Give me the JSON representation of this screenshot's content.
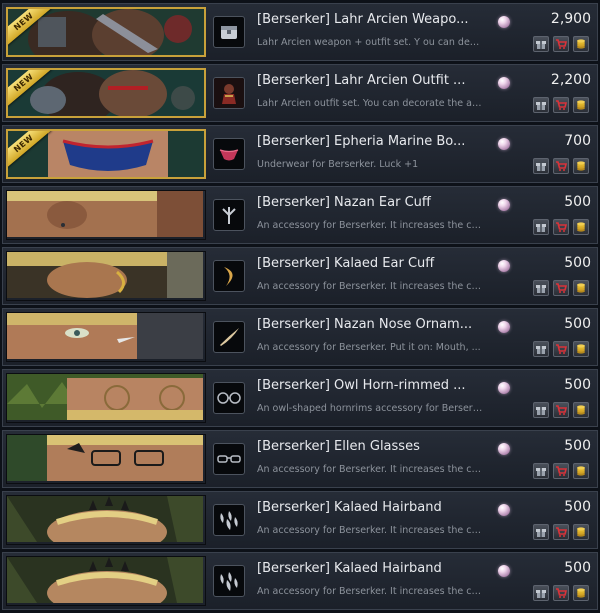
{
  "new_badge_text": "NEW",
  "colors": {
    "title": "#e8eaee",
    "description": "#8d939c",
    "price": "#f0f0f0",
    "new_badge": "#d1a726",
    "cart_icon": "#d9333a",
    "coin_icon": "#e0b52c"
  },
  "items": [
    {
      "title": "[Berserker] Lahr Arcien Weapo...",
      "description": "Lahr Arcien weapon + outfit set. Y ou can dec...",
      "price": "2,900",
      "is_new": true,
      "banner_scene": "armored-warrior-green",
      "thumb_icon": "chest-box-icon"
    },
    {
      "title": "[Berserker] Lahr Arcien Outfit ...",
      "description": "Lahr Arcien outfit set. You can decorate the ar...",
      "price": "2,200",
      "is_new": true,
      "banner_scene": "armored-warrior-teal",
      "thumb_icon": "armor-outfit-icon"
    },
    {
      "title": "[Berserker] Epheria Marine Bo...",
      "description": "Underwear for Berserker. Luck +1",
      "price": "700",
      "is_new": true,
      "banner_scene": "underwear-model",
      "thumb_icon": "underwear-icon"
    },
    {
      "title": "[Berserker] Nazan Ear Cuff",
      "description": "An accessory for Berserker. It increases the ch...",
      "price": "500",
      "is_new": false,
      "banner_scene": "ear-closeup",
      "thumb_icon": "ear-cuff-icon"
    },
    {
      "title": "[Berserker] Kalaed Ear Cuff",
      "description": "An accessory for Berserker. It increases the ch...",
      "price": "500",
      "is_new": false,
      "banner_scene": "ear-closeup-gold",
      "thumb_icon": "crescent-ear-cuff-icon"
    },
    {
      "title": "[Berserker] Nazan Nose Ornam...",
      "description": "An accessory for Berserker. Put it on: Mouth, ...",
      "price": "500",
      "is_new": false,
      "banner_scene": "face-closeup",
      "thumb_icon": "nose-ornament-icon"
    },
    {
      "title": "[Berserker] Owl Horn-rimmed ...",
      "description": "An owl-shaped hornrims accessory for Berserk...",
      "price": "500",
      "is_new": false,
      "banner_scene": "face-glasses-forest",
      "thumb_icon": "round-glasses-icon"
    },
    {
      "title": "[Berserker] Ellen Glasses",
      "description": "An accessory for Berserker. It increases the ch...",
      "price": "500",
      "is_new": false,
      "banner_scene": "face-glasses-green",
      "thumb_icon": "glasses-icon"
    },
    {
      "title": "[Berserker] Kalaed Hairband",
      "description": "An accessory for Berserker. It increases the ch...",
      "price": "500",
      "is_new": false,
      "banner_scene": "horned-head-forest",
      "thumb_icon": "hairband-icon"
    },
    {
      "title": "[Berserker] Kalaed Hairband",
      "description": "An accessory for Berserker. It increases the ch...",
      "price": "500",
      "is_new": false,
      "banner_scene": "horned-head-forest",
      "thumb_icon": "hairband-icon"
    }
  ]
}
